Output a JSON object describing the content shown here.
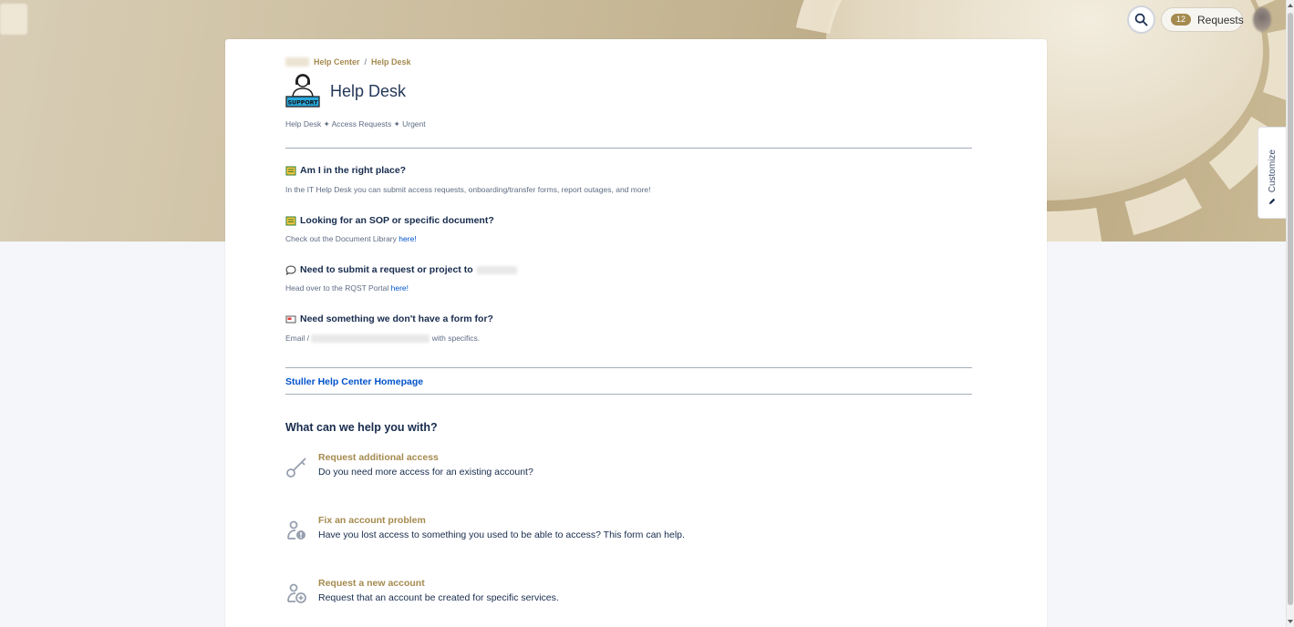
{
  "header": {
    "requests_label": "Requests",
    "requests_count": "12",
    "customize_label": "Customize"
  },
  "breadcrumb": {
    "items": [
      "Help Center",
      "Help Desk"
    ],
    "separator": "/"
  },
  "page": {
    "title": "Help Desk",
    "subtitle": "Help Desk ✦ Access Requests ✦ Urgent"
  },
  "sections": [
    {
      "icon": "book-icon",
      "title": "Am I in the right place?",
      "text": "In the IT Help Desk you can submit access requests, onboarding/transfer forms, report outages, and more!"
    },
    {
      "icon": "book-icon",
      "title": "Looking for an SOP or specific document?",
      "text": "Check out the Document Library",
      "link": "here!"
    },
    {
      "icon": "speech-bubble-icon",
      "title": "Need to submit a request or project to",
      "text": "Head over to the RQST Portal",
      "link": "here!"
    },
    {
      "icon": "envelope-icon",
      "title": "Need something we don't have a form for?",
      "text_before": "Email /",
      "text_after": "with specifics."
    }
  ],
  "homepage_link": "Stuller Help Center Homepage",
  "help_heading": "What can we help you with?",
  "requests": [
    {
      "icon": "key-icon",
      "title": "Request additional access",
      "description": "Do you need more access for an existing account?"
    },
    {
      "icon": "user-alert-icon",
      "title": "Fix an account problem",
      "description": "Have you lost access to something you used to be able to access? This form can help."
    },
    {
      "icon": "user-add-icon",
      "title": "Request a new account",
      "description": "Request that an account be created for specific services."
    }
  ],
  "colors": {
    "accent": "#a58a4f",
    "link": "#0052cc",
    "title": "#253858"
  }
}
